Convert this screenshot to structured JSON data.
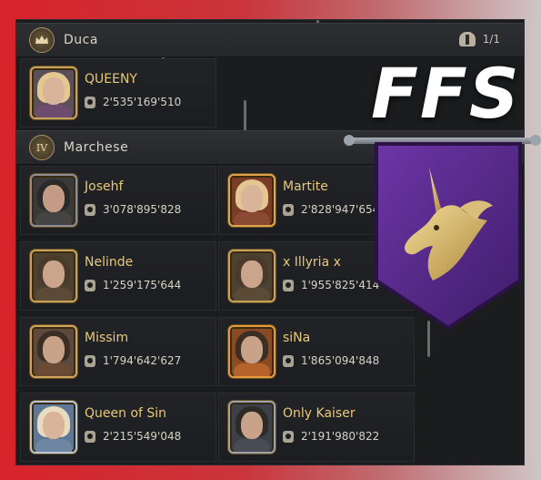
{
  "ranks": [
    {
      "emblem": "",
      "title": "Duca",
      "count": "1/1"
    },
    {
      "emblem": "IV",
      "title": "Marchese"
    }
  ],
  "duca_member": {
    "name": "QUEENY",
    "power": "2'535'169'510"
  },
  "marchese_members": [
    {
      "name": "Josehf",
      "power": "3'078'895'828"
    },
    {
      "name": "Martite",
      "power": "2'828'947'654"
    },
    {
      "name": "Nelinde",
      "power": "1'259'175'644"
    },
    {
      "name": "x Illyria x",
      "power": "1'955'825'414"
    },
    {
      "name": "Missim",
      "power": "1'794'642'627"
    },
    {
      "name": "siNa",
      "power": "1'865'094'848"
    },
    {
      "name": "Queen of Sin",
      "power": "2'215'549'048"
    },
    {
      "name": "Only Kaiser",
      "power": "2'191'980'822"
    }
  ],
  "overlay": {
    "text": "FFS",
    "banner_color": "#5a2a8c",
    "emblem": "unicorn-head-icon"
  },
  "colors": {
    "name_gold": "#e8c87a",
    "panel": "#1b1c1e"
  }
}
